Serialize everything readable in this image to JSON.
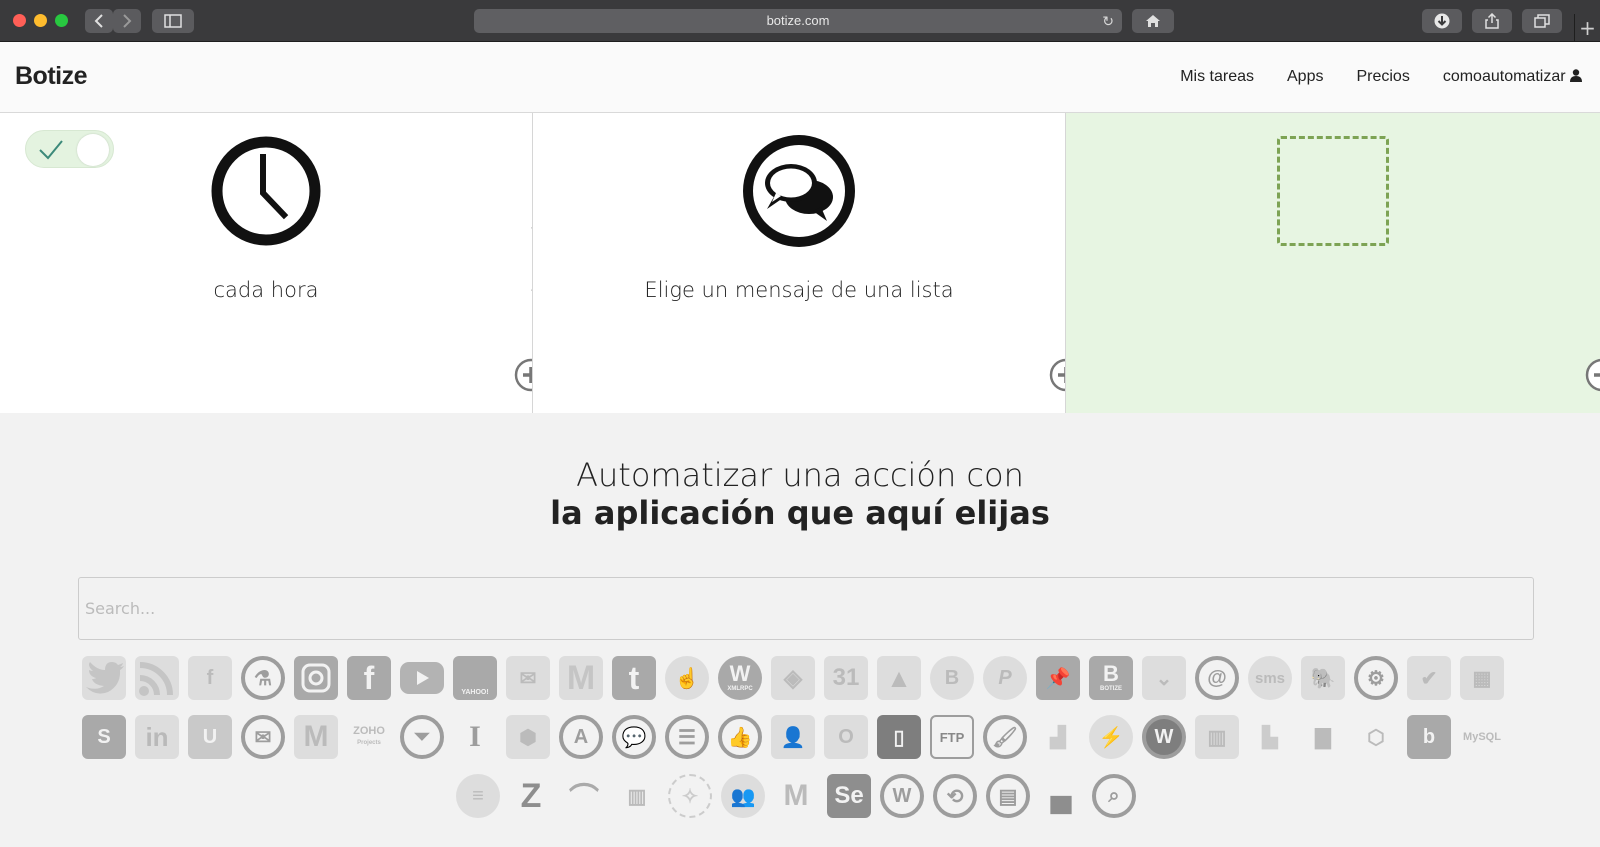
{
  "browser": {
    "url": "botize.com",
    "colors": {
      "close": "#ff5f57",
      "minimize": "#febc2e",
      "zoom": "#28c840"
    }
  },
  "header": {
    "brand": "Botize",
    "nav": [
      "Mis tareas",
      "Apps",
      "Precios",
      "comoautomatizar"
    ]
  },
  "steps": [
    {
      "label": "cada hora",
      "icon": "clock-icon"
    },
    {
      "label": "Elige un mensaje de una lista",
      "icon": "chat-bubbles-icon"
    },
    {
      "label": "",
      "icon": "empty-slot"
    }
  ],
  "section": {
    "title_line1": "Automatizar una acción con",
    "title_line2": "la aplicación que aquí elijas"
  },
  "search": {
    "placeholder": "Search...",
    "value": ""
  },
  "apps": {
    "row1": [
      "twitter",
      "rss",
      "facebook-pages",
      "lab",
      "instagram",
      "facebook",
      "youtube",
      "yahoo-weather",
      "mailchimp",
      "gmail",
      "tumblr",
      "touch",
      "wordpress-xmlrpc",
      "dropbox",
      "calendar",
      "google-drive",
      "blogger",
      "pinterest",
      "pushpin",
      "botize",
      "pocket",
      "email-at",
      "sms",
      "evernote",
      "webhooks",
      "todoist",
      "spreadsheet"
    ],
    "row2": [
      "skype",
      "linkedin",
      "magnet",
      "mail",
      "gmail-alt",
      "zoho-projects",
      "filter",
      "instapaper",
      "box",
      "app-store",
      "chat",
      "list",
      "like",
      "contacts",
      "outlook",
      "document",
      "ftp",
      "brush",
      "bar-step",
      "messenger",
      "wordpress-com",
      "trello",
      "blocks",
      "bar-chart",
      "aws",
      "bing",
      "mysql"
    ],
    "row3": [
      "stack",
      "zendesk",
      "arch",
      "building",
      "compass",
      "group",
      "medium",
      "selenium",
      "wordpress",
      "sync",
      "doc-circle",
      "unsplash",
      "doc-search"
    ],
    "labels": {
      "yahoo": "YAHOO!",
      "xmlrpc": "XMLRPC",
      "calendar": "31",
      "botize": "BOTIZE",
      "sms": "sms",
      "ftp": "FTP",
      "zoho": "ZOHO",
      "zoho_sub": "Projects",
      "mysql": "MySQL",
      "selenium": "Se"
    }
  }
}
